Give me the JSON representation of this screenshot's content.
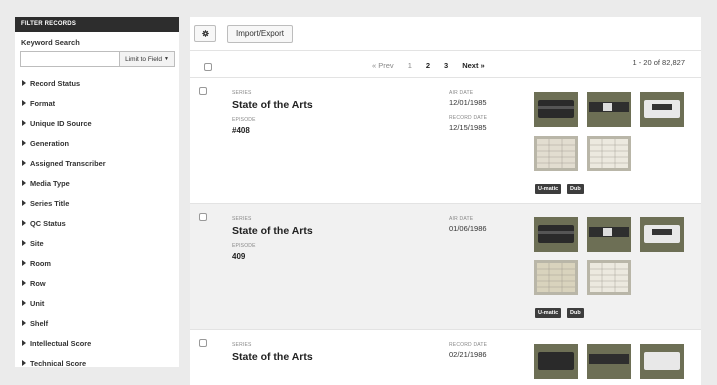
{
  "sidebar": {
    "header": "FILTER RECORDS",
    "keyword_label": "Keyword Search",
    "limit_label": "Limit to Field",
    "facets": [
      "Record Status",
      "Format",
      "Unique ID Source",
      "Generation",
      "Assigned Transcriber",
      "Media Type",
      "Series Title",
      "QC Status",
      "Site",
      "Room",
      "Row",
      "Unit",
      "Shelf",
      "Intellectual Score",
      "Technical Score"
    ]
  },
  "toolbar": {
    "import_label": "Import/Export"
  },
  "pager": {
    "prev": "« Prev",
    "pages": [
      "1",
      "2",
      "3"
    ],
    "next": "Next »",
    "count": "1 - 20 of 82,827"
  },
  "labels": {
    "series": "SERIES",
    "episode": "EPISODE",
    "air_date": "AIR DATE",
    "record_date": "RECORD DATE"
  },
  "records": [
    {
      "series": "State of the Arts",
      "episode": "#408",
      "air_date": "12/01/1985",
      "record_date": "12/15/1985",
      "tags": [
        "U-matic",
        "Dub"
      ]
    },
    {
      "series": "State of the Arts",
      "episode": "409",
      "air_date": "01/06/1986",
      "tags": [
        "U-matic",
        "Dub"
      ]
    },
    {
      "series": "State of the Arts",
      "record_date": "02/21/1986"
    }
  ],
  "colors": {
    "header_bg": "#2d2d2d",
    "thumb_bg": "#6d6f55",
    "tag_bg": "#3d3d3d"
  }
}
